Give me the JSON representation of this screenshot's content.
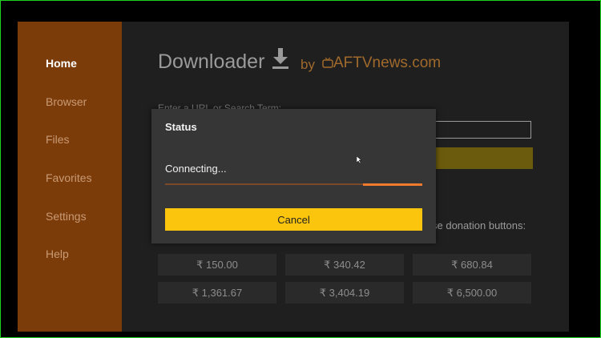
{
  "sidebar": {
    "items": [
      {
        "label": "Home",
        "active": true
      },
      {
        "label": "Browser",
        "active": false
      },
      {
        "label": "Files",
        "active": false
      },
      {
        "label": "Favorites",
        "active": false
      },
      {
        "label": "Settings",
        "active": false
      },
      {
        "label": "Help",
        "active": false
      }
    ]
  },
  "header": {
    "app_name": "Downloader",
    "by_text": "by",
    "brand": "AFTVnews.com",
    "download_icon": "download-icon",
    "tv_icon": "tv-icon"
  },
  "main": {
    "url_label": "Enter a URL or Search Term:",
    "url_value": "",
    "donation_label": "se donation buttons:",
    "donations": [
      "₹ 150.00",
      "₹ 340.42",
      "₹ 680.84",
      "₹ 1,361.67",
      "₹ 3,404.19",
      "₹ 6,500.00"
    ]
  },
  "dialog": {
    "title": "Status",
    "status": "Connecting...",
    "progress": 0.23,
    "cancel_label": "Cancel"
  },
  "colors": {
    "sidebar_bg": "#7b3c0a",
    "accent_yellow": "#fbc50d",
    "progress_orange": "#f07a2e",
    "brand_orange": "#a06a2c"
  }
}
